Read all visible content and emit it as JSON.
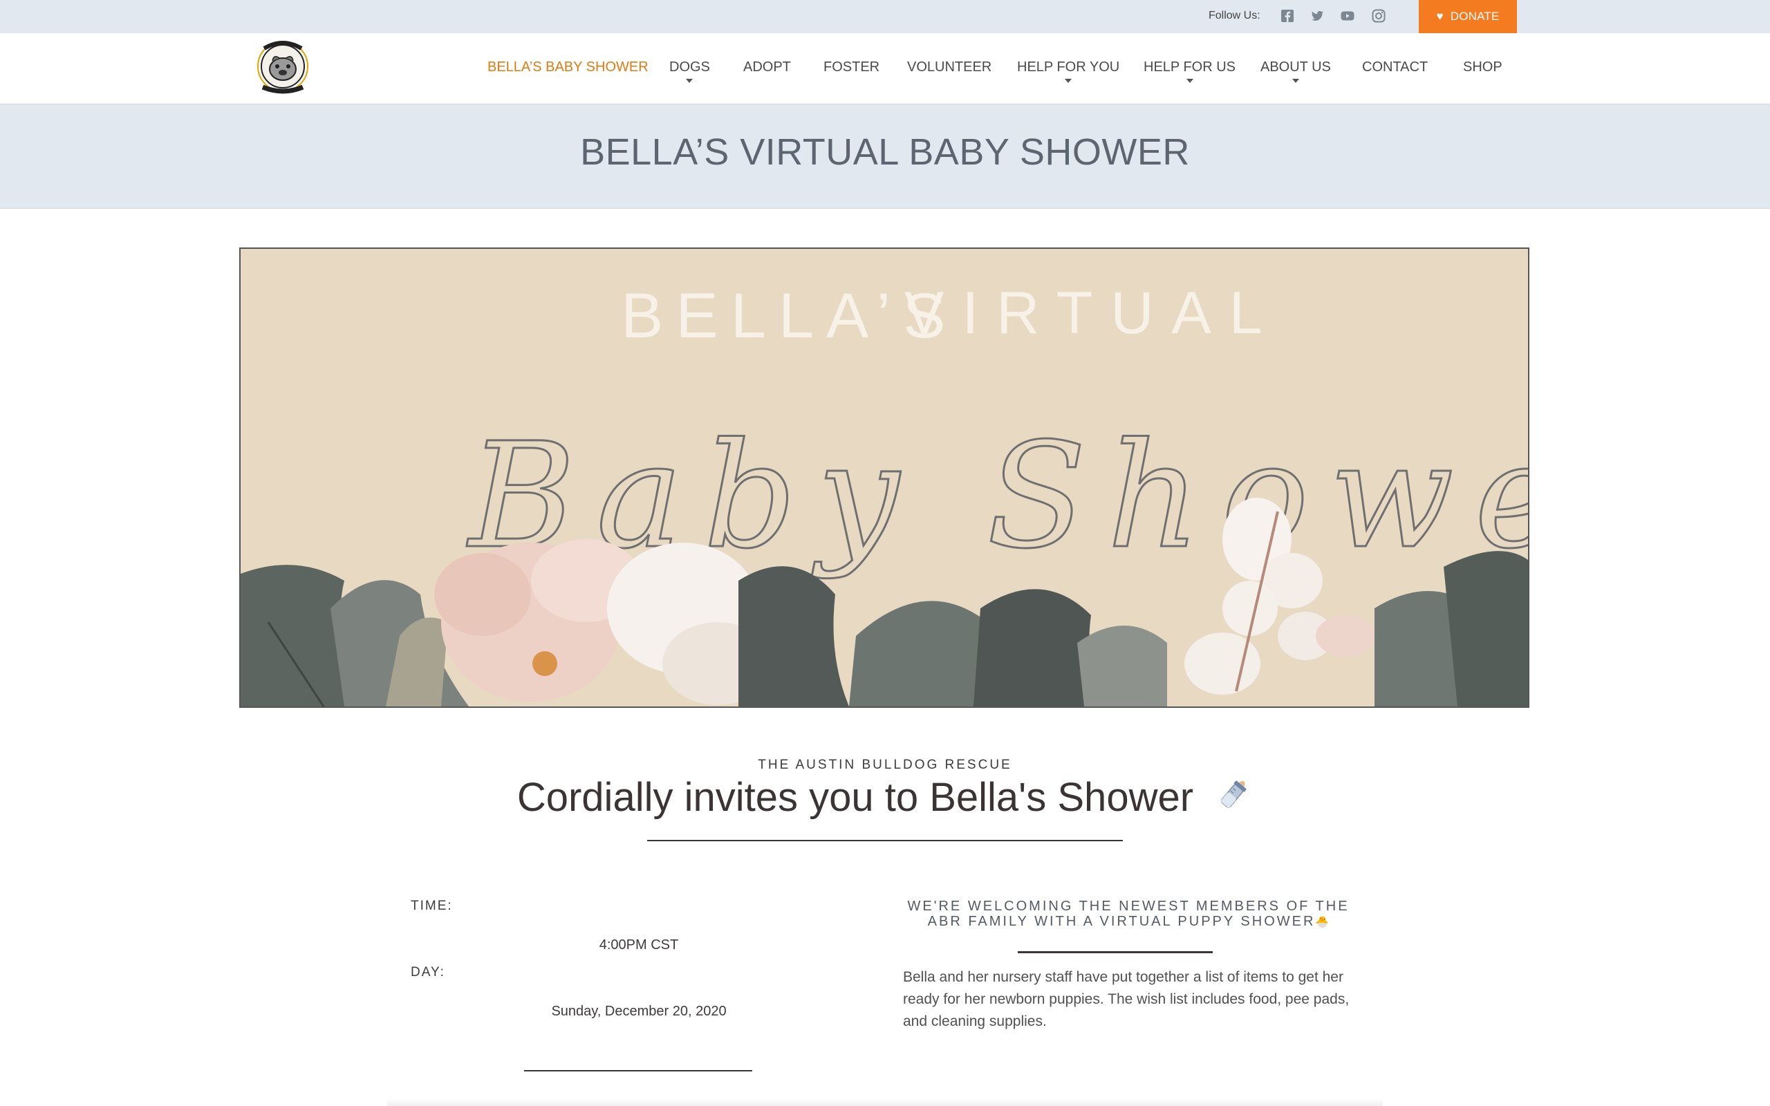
{
  "topbar": {
    "follow_label": "Follow Us:",
    "social": [
      "facebook-icon",
      "twitter-icon",
      "youtube-icon",
      "instagram-icon"
    ],
    "donate_label": "DONATE"
  },
  "nav": {
    "items": [
      {
        "label": "BELLA’S BABY SHOWER",
        "active": true,
        "dropdown": false
      },
      {
        "label": "DOGS",
        "active": false,
        "dropdown": true
      },
      {
        "label": "ADOPT",
        "active": false,
        "dropdown": false
      },
      {
        "label": "FOSTER",
        "active": false,
        "dropdown": false
      },
      {
        "label": "VOLUNTEER",
        "active": false,
        "dropdown": false
      },
      {
        "label": "HELP FOR YOU",
        "active": false,
        "dropdown": true
      },
      {
        "label": "HELP FOR US",
        "active": false,
        "dropdown": true
      },
      {
        "label": "ABOUT US",
        "active": false,
        "dropdown": true
      },
      {
        "label": "CONTACT",
        "active": false,
        "dropdown": false
      },
      {
        "label": "SHOP",
        "active": false,
        "dropdown": false
      }
    ]
  },
  "page": {
    "title": "BELLA’S VIRTUAL BABY SHOWER"
  },
  "banner": {
    "line1_a": "BELLA’S",
    "line1_b": "VIRTUAL",
    "script": "Baby Shower"
  },
  "invitation": {
    "kicker": "THE AUSTIN BULLDOG RESCUE",
    "heading": "Cordially invites you to Bella's Shower",
    "heading_icon": "baby-bottle-icon"
  },
  "details": {
    "time_label": "TIME:",
    "time_value": "4:00PM CST",
    "day_label": "DAY:",
    "day_value": "Sunday, December 20, 2020"
  },
  "welcome": {
    "heading": "WE'RE WELCOMING THE NEWEST MEMBERS OF THE ABR FAMILY WITH A VIRTUAL PUPPY SHOWER",
    "heading_emoji": "🐣",
    "body": "Bella and her nursery staff have put together a list of items to get her ready for her newborn puppies. The wish list includes food, pee pads, and cleaning supplies."
  },
  "colors": {
    "accent": "#f47b20",
    "nav_active": "#e07b12",
    "band": "#e1e8f0",
    "banner_bg": "#e8d9c3"
  }
}
